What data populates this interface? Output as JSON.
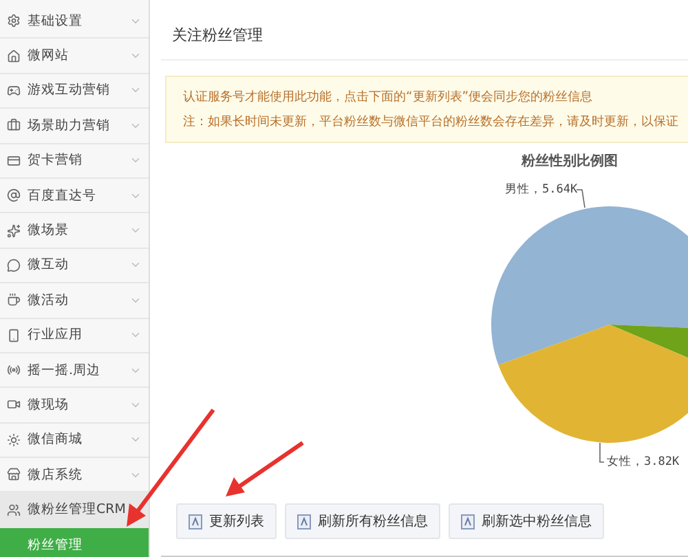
{
  "sidebar": {
    "items": [
      {
        "label": "基础设置",
        "selected": false
      },
      {
        "label": "微网站",
        "selected": false
      },
      {
        "label": "游戏互动营销",
        "selected": false
      },
      {
        "label": "场景助力营销",
        "selected": false
      },
      {
        "label": "贺卡营销",
        "selected": false
      },
      {
        "label": "百度直达号",
        "selected": false
      },
      {
        "label": "微场景",
        "selected": false
      },
      {
        "label": "微互动",
        "selected": false
      },
      {
        "label": "微活动",
        "selected": false
      },
      {
        "label": "行业应用",
        "selected": false
      },
      {
        "label": "摇一摇.周边",
        "selected": false
      },
      {
        "label": "微现场",
        "selected": false
      },
      {
        "label": "微信商城",
        "selected": false
      },
      {
        "label": "微店系统",
        "selected": false
      },
      {
        "label": "微粉丝管理CRM",
        "selected": false,
        "expanded": true,
        "children": [
          {
            "label": "粉丝管理",
            "selected": true
          }
        ]
      }
    ]
  },
  "main": {
    "title": "关注粉丝管理",
    "notice": [
      "认证服务号才能使用此功能，点击下面的“更新列表”便会同步您的粉丝信息",
      "注：如果长时间未更新，平台粉丝数与微信平台的粉丝数会存在差异，请及时更新，以保证"
    ],
    "chart_data": {
      "type": "pie",
      "title": "粉丝性别比例图",
      "categories": [
        "男性，5.64K",
        "女性，3.82K",
        null
      ],
      "values": [
        5.64,
        3.82,
        0.57
      ]
    },
    "buttons": [
      "更新列表",
      "刷新所有粉丝信息",
      "刷新选中粉丝信息"
    ]
  }
}
